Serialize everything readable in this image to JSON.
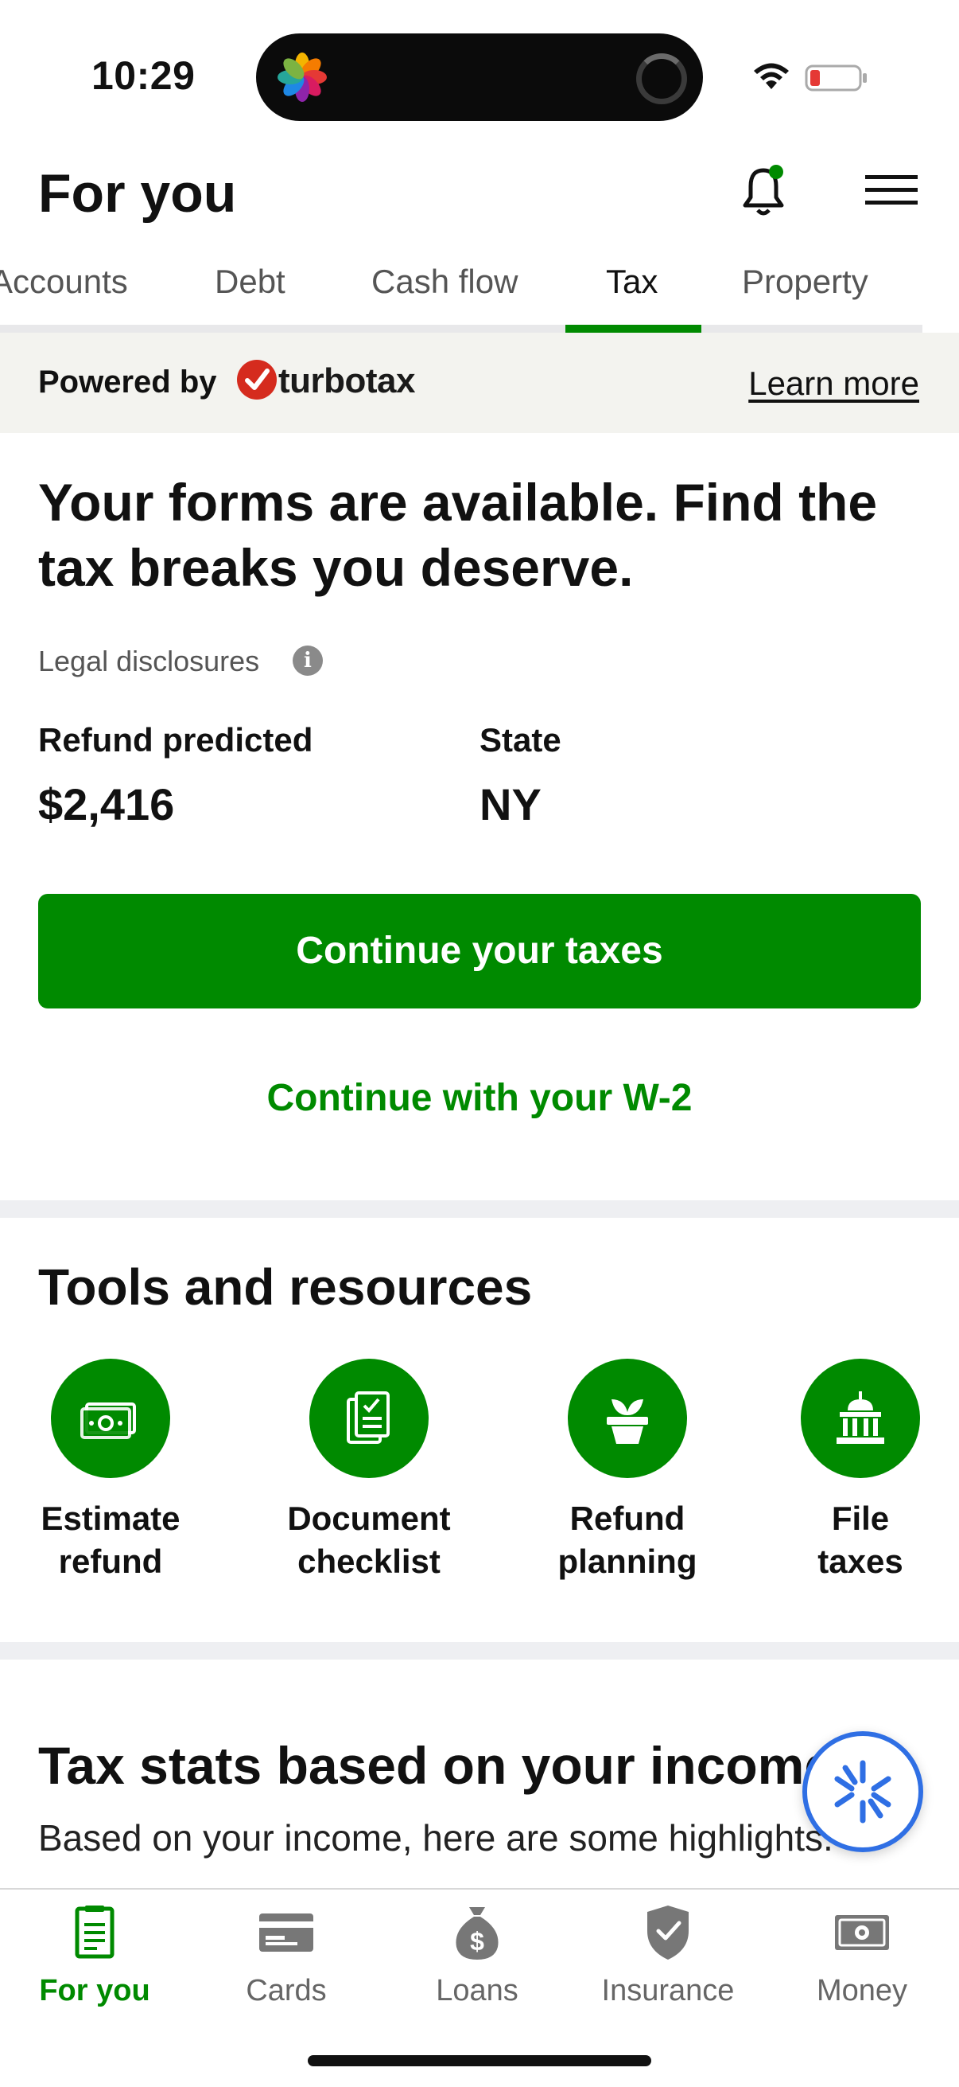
{
  "status_bar": {
    "time": "10:29"
  },
  "header": {
    "title": "For you"
  },
  "tabs": [
    {
      "label": "Accounts"
    },
    {
      "label": "Debt"
    },
    {
      "label": "Cash flow"
    },
    {
      "label": "Tax"
    },
    {
      "label": "Property"
    }
  ],
  "active_tab": "Tax",
  "banner": {
    "powered_by": "Powered by",
    "brand": "turbotax",
    "learn_more": "Learn more"
  },
  "main": {
    "headline": "Your forms are available. Find the tax breaks you deserve.",
    "legal": "Legal disclosures",
    "refund_label": "Refund predicted",
    "refund_value": "$2,416",
    "state_label": "State",
    "state_value": "NY",
    "primary_button": "Continue your taxes",
    "secondary_link": "Continue with your W-2"
  },
  "tools": {
    "title": "Tools and resources",
    "items": [
      {
        "line1": "Estimate",
        "line2": "refund",
        "icon": "money-icon"
      },
      {
        "line1": "Document",
        "line2": "checklist",
        "icon": "document-check-icon"
      },
      {
        "line1": "Refund",
        "line2": "planning",
        "icon": "plant-pot-icon"
      },
      {
        "line1": "File",
        "line2": "taxes",
        "icon": "government-building-icon"
      }
    ]
  },
  "stats": {
    "title": "Tax stats based on your income",
    "subtitle": "Based on your income, here are some highlights."
  },
  "bottom_nav": [
    {
      "label": "For you",
      "icon": "document-icon"
    },
    {
      "label": "Cards",
      "icon": "card-icon"
    },
    {
      "label": "Loans",
      "icon": "money-bag-icon"
    },
    {
      "label": "Insurance",
      "icon": "shield-check-icon"
    },
    {
      "label": "Money",
      "icon": "cash-icon"
    }
  ],
  "colors": {
    "brand_green": "#008a00",
    "turbotax_red": "#d52b1e",
    "fab_blue": "#2f6fe4"
  }
}
